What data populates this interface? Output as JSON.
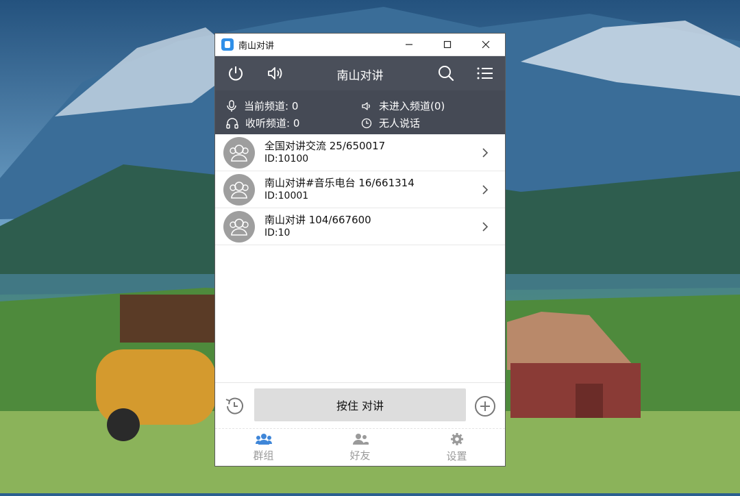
{
  "window": {
    "title": "南山对讲",
    "minimize_glyph": "—",
    "maximize_glyph": "☐",
    "close_glyph": "✕"
  },
  "toolbar": {
    "title": "南山对讲",
    "icons": [
      "power-icon",
      "speaker-icon",
      "search-icon",
      "menu-icon"
    ]
  },
  "status": {
    "current_channel": "当前频道: 0",
    "listen_channel": "收听频道: 0",
    "not_in_channel": "未进入频道(0)",
    "nobody_speaking": "无人说话"
  },
  "channels": [
    {
      "name": "全国对讲交流 25/650017",
      "id": "ID:10100"
    },
    {
      "name": "南山对讲#音乐电台 16/661314",
      "id": "ID:10001"
    },
    {
      "name": "南山对讲 104/667600",
      "id": "ID:10"
    }
  ],
  "ptt": {
    "label": "按住 对讲"
  },
  "tabs": [
    {
      "label": "群组",
      "icon": "group-icon",
      "active": true
    },
    {
      "label": "好友",
      "icon": "friends-icon",
      "active": false
    },
    {
      "label": "设置",
      "icon": "gear-icon",
      "active": false
    }
  ],
  "colors": {
    "toolbar": "#4a4f5a",
    "status": "#454a55",
    "active_tab": "#3f86d8",
    "inactive_tab": "#9a9a9a"
  }
}
